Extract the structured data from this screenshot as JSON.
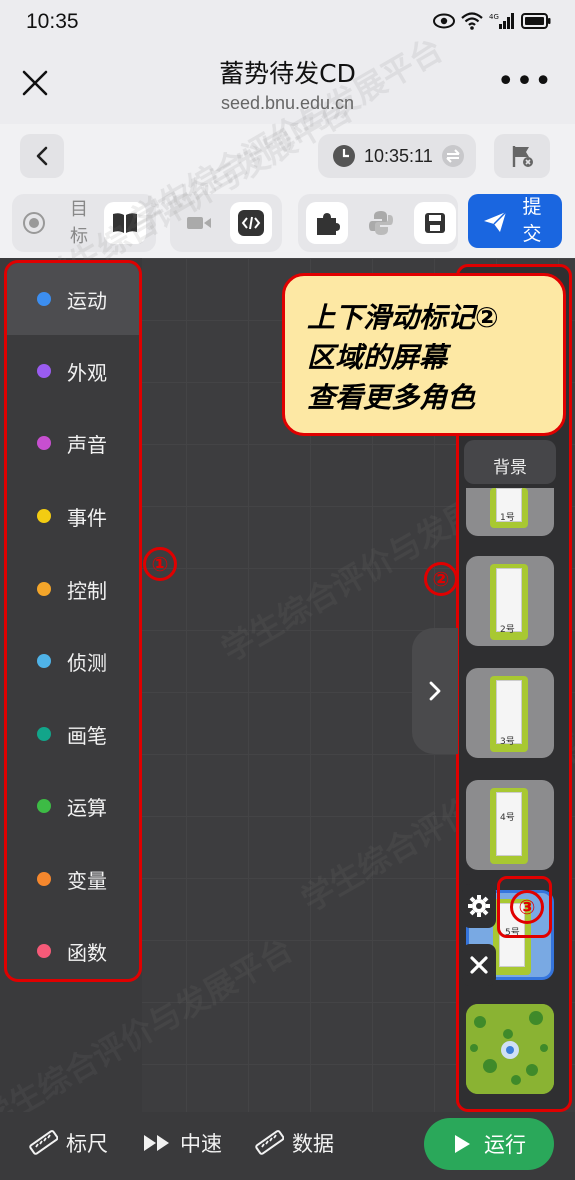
{
  "status_bar": {
    "time": "10:35"
  },
  "title_bar": {
    "title": "蓄势待发CD",
    "url": "seed.bnu.edu.cn",
    "more": "•••"
  },
  "toolbar": {
    "timer": "10:35:11",
    "goal_label_1": "目",
    "goal_label_2": "标",
    "submit_label_1": "提",
    "submit_label_2": "交"
  },
  "categories": [
    {
      "name": "运动",
      "color": "#3c8ef0"
    },
    {
      "name": "外观",
      "color": "#9a5cf0"
    },
    {
      "name": "声音",
      "color": "#c74fd0"
    },
    {
      "name": "事件",
      "color": "#f3cc12"
    },
    {
      "name": "控制",
      "color": "#f3a52a"
    },
    {
      "name": "侦测",
      "color": "#4fb3e8"
    },
    {
      "name": "画笔",
      "color": "#12a58a"
    },
    {
      "name": "运算",
      "color": "#3dbb45"
    },
    {
      "name": "变量",
      "color": "#f5872d"
    },
    {
      "name": "函数",
      "color": "#f55a78"
    }
  ],
  "marks": {
    "m1": "①",
    "m2": "②",
    "m3": "③"
  },
  "tooltip": {
    "line1": "上下滑动标记②",
    "line2": "区域的屏幕",
    "line3": "查看更多角色"
  },
  "sprite_panel": {
    "background_tab": "背景",
    "sprites": [
      {
        "label": "1号"
      },
      {
        "label": "2号"
      },
      {
        "label": "3号"
      },
      {
        "label": "4号"
      },
      {
        "label": "5号"
      }
    ]
  },
  "bottom_bar": {
    "ruler": "标尺",
    "speed": "中速",
    "data": "数据",
    "run": "运行"
  },
  "watermark": "学生综合评价与发展平台"
}
